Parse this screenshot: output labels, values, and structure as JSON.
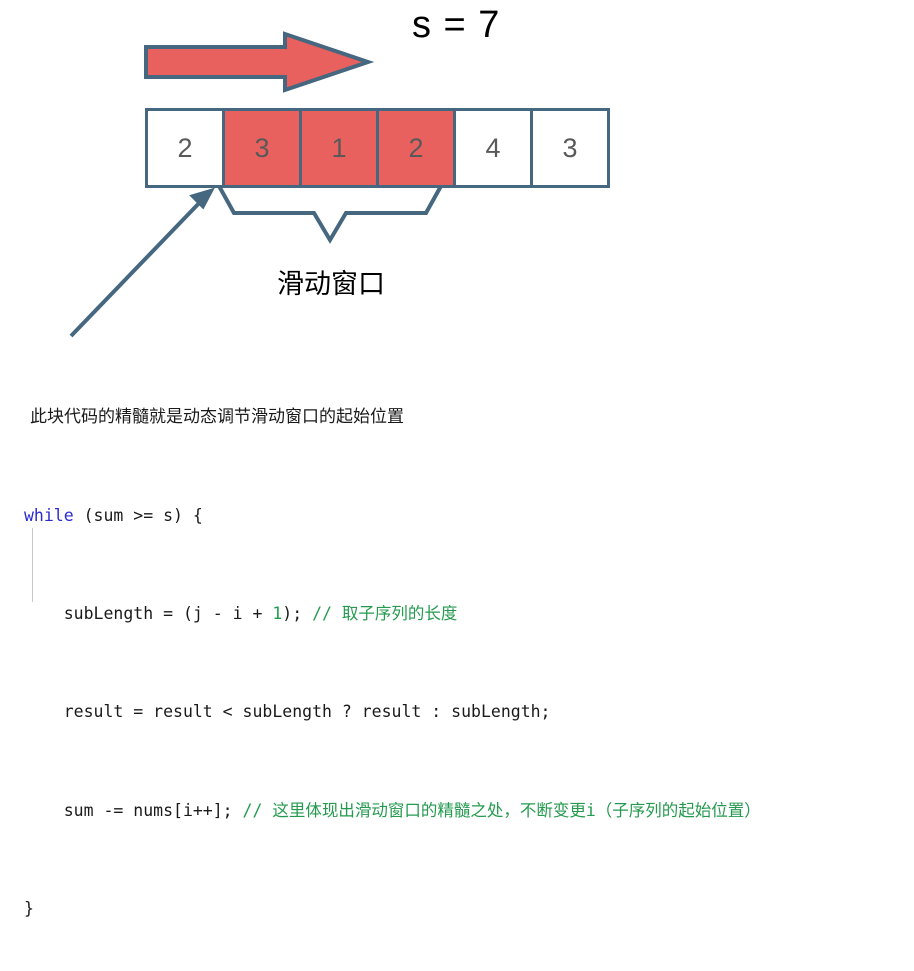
{
  "diagram": {
    "title_label": "s = 7",
    "window_caption": "滑动窗口",
    "array": {
      "values": [
        "2",
        "3",
        "1",
        "2",
        "4",
        "3"
      ],
      "window_start_index": 1,
      "window_end_index": 3,
      "in_window": [
        false,
        true,
        true,
        true,
        false,
        false
      ]
    },
    "colors": {
      "highlight": "#e8615f",
      "stroke": "#45677f",
      "cell_text": "#595959",
      "background": "#ffffff"
    },
    "icons": {
      "direction_arrow": "right-arrow-icon",
      "window_brace": "curly-brace-icon",
      "pointer_arrow": "diagonal-arrow-icon"
    }
  },
  "code": {
    "note": "此块代码的精髓就是动态调节滑动窗口的起始位置",
    "lines": [
      {
        "kw": "while",
        "rest": " (sum >= s) {"
      },
      {
        "indent": "    subLength = (j - i + ",
        "num": "1",
        "tail": "); ",
        "comment": "// 取子序列的长度"
      },
      {
        "text": "    result = result < subLength ? result : subLength;"
      },
      {
        "indent": "    sum -= nums[i++]; ",
        "comment": "// 这里体现出滑动窗口的精髓之处，不断变更i（子序列的起始位置）"
      },
      {
        "text": "}"
      }
    ],
    "colors": {
      "keyword": "#2b2bd0",
      "comment": "#259a4f",
      "number": "#1e9d4f",
      "text": "#1a1a1a"
    }
  }
}
